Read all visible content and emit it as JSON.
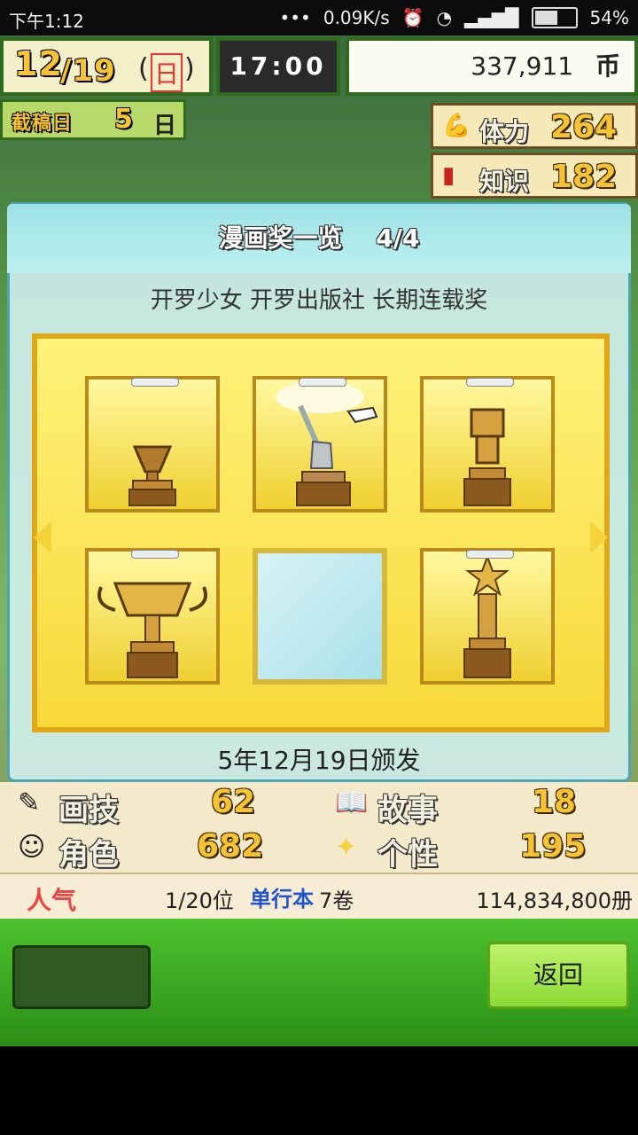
{
  "status_bar": {
    "time": "下午1:12",
    "net_speed": "0.09K/s",
    "battery": "54%"
  },
  "hud": {
    "month": "12",
    "day": "/19",
    "weekday": "日",
    "clock": "17:00",
    "money": "337,911",
    "currency_icon": "币",
    "deadline_label": "截稿日",
    "deadline_value": "5",
    "deadline_unit": "日",
    "stamina_label": "体力",
    "stamina_value": "264",
    "knowledge_label": "知识",
    "knowledge_value": "182"
  },
  "dialog": {
    "title": "漫画奖一览",
    "page": "4/4",
    "subtitle": "开罗少女 开罗出版社 长期连载奖",
    "issued": "5年12月19日颁发"
  },
  "stats": {
    "drawing_label": "画技",
    "drawing_value": "62",
    "story_label": "故事",
    "story_value": "18",
    "character_label": "角色",
    "character_value": "682",
    "personality_label": "个性",
    "personality_value": "195"
  },
  "popularity": {
    "label": "人气",
    "rank": "1/20位",
    "volumes_label": "单行本",
    "volumes": "7卷",
    "copies": "114,834,800册"
  },
  "buttons": {
    "back": "返回"
  },
  "colors": {
    "gold": "#f8d93a",
    "teal": "#4aa6b0",
    "green": "#4ec22f"
  }
}
